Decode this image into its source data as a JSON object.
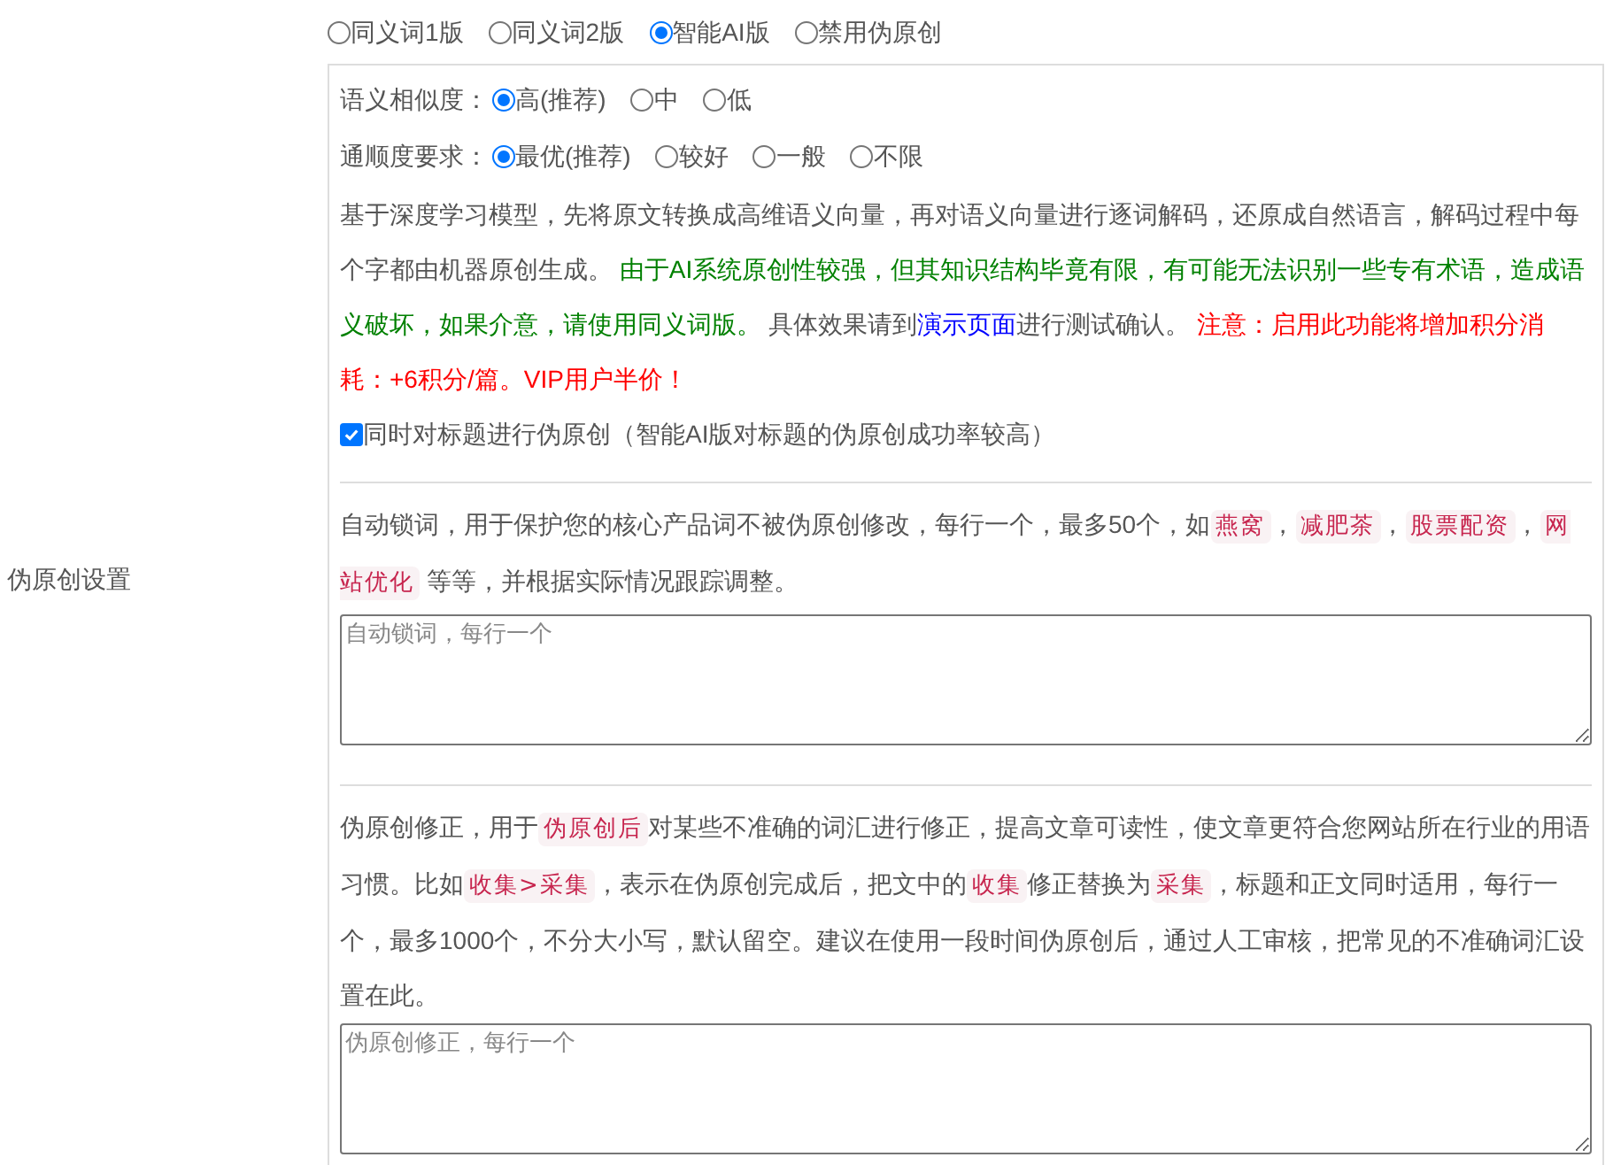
{
  "section_label": "伪原创设置",
  "mode_options": [
    {
      "label": "同义词1版",
      "selected": false
    },
    {
      "label": "同义词2版",
      "selected": false
    },
    {
      "label": "智能AI版",
      "selected": true
    },
    {
      "label": "禁用伪原创",
      "selected": false
    }
  ],
  "similarity": {
    "label": "语义相似度：",
    "options": [
      {
        "label": "高(推荐)",
        "selected": true
      },
      {
        "label": "中",
        "selected": false
      },
      {
        "label": "低",
        "selected": false
      }
    ]
  },
  "fluency": {
    "label": "通顺度要求：",
    "options": [
      {
        "label": "最优(推荐)",
        "selected": true
      },
      {
        "label": "较好",
        "selected": false
      },
      {
        "label": "一般",
        "selected": false
      },
      {
        "label": "不限",
        "selected": false
      }
    ]
  },
  "ai_description": [
    {
      "kind": "text",
      "text": "基于深度学习模型，先将原文转换成高维语义向量，再对语义向量进行逐词解码，还原成自然语言，解码过程中每个字都由机器原创生成。 "
    },
    {
      "kind": "note",
      "text": "由于AI系统原创性较强，但其知识结构毕竟有限，有可能无法识别一些专有术语，造成语义破坏，如果介意，请使用同义词版。"
    },
    {
      "kind": "text",
      "text": " 具体效果请到"
    },
    {
      "kind": "link",
      "text": "演示页面"
    },
    {
      "kind": "text",
      "text": "进行测试确认。 "
    },
    {
      "kind": "warning",
      "text": "注意：启用此功能将增加积分消耗：+6积分/篇。VIP用户半价！"
    }
  ],
  "title_option": {
    "label": "同时对标题进行伪原创（智能AI版对标题的伪原创成功率较高）",
    "checked": true
  },
  "lock_words": {
    "description": [
      {
        "kind": "text",
        "text": "自动锁词，用于保护您的核心产品词不被伪原创修改，每行一个，最多50个，如"
      },
      {
        "kind": "tag",
        "text": "燕窝"
      },
      {
        "kind": "text",
        "text": "，"
      },
      {
        "kind": "tag",
        "text": "减肥茶"
      },
      {
        "kind": "text",
        "text": "，"
      },
      {
        "kind": "tag",
        "text": "股票配资"
      },
      {
        "kind": "text",
        "text": "，"
      },
      {
        "kind": "tag",
        "text": "网站优化"
      },
      {
        "kind": "text",
        "text": " 等等，并根据实际情况跟踪调整。"
      }
    ],
    "placeholder": "自动锁词，每行一个"
  },
  "correction": {
    "description": [
      {
        "kind": "text",
        "text": "伪原创修正，用于"
      },
      {
        "kind": "tag",
        "text": "伪原创后"
      },
      {
        "kind": "text",
        "text": "对某些不准确的词汇进行修正，提高文章可读性，使文章更符合您网站所在行业的用语习惯。比如"
      },
      {
        "kind": "tag",
        "text": "收集>采集"
      },
      {
        "kind": "text",
        "text": "，表示在伪原创完成后，把文中的"
      },
      {
        "kind": "tag",
        "text": "收集"
      },
      {
        "kind": "text",
        "text": "修正替换为"
      },
      {
        "kind": "tag",
        "text": "采集"
      },
      {
        "kind": "text",
        "text": "，标题和正文同时适用，每行一个，最多1000个，不分大小写，默认留空。建议在使用一段时间伪原创后，通过人工审核，把常见的不准确词汇设置在此。"
      }
    ],
    "placeholder": "伪原创修正，每行一个"
  }
}
